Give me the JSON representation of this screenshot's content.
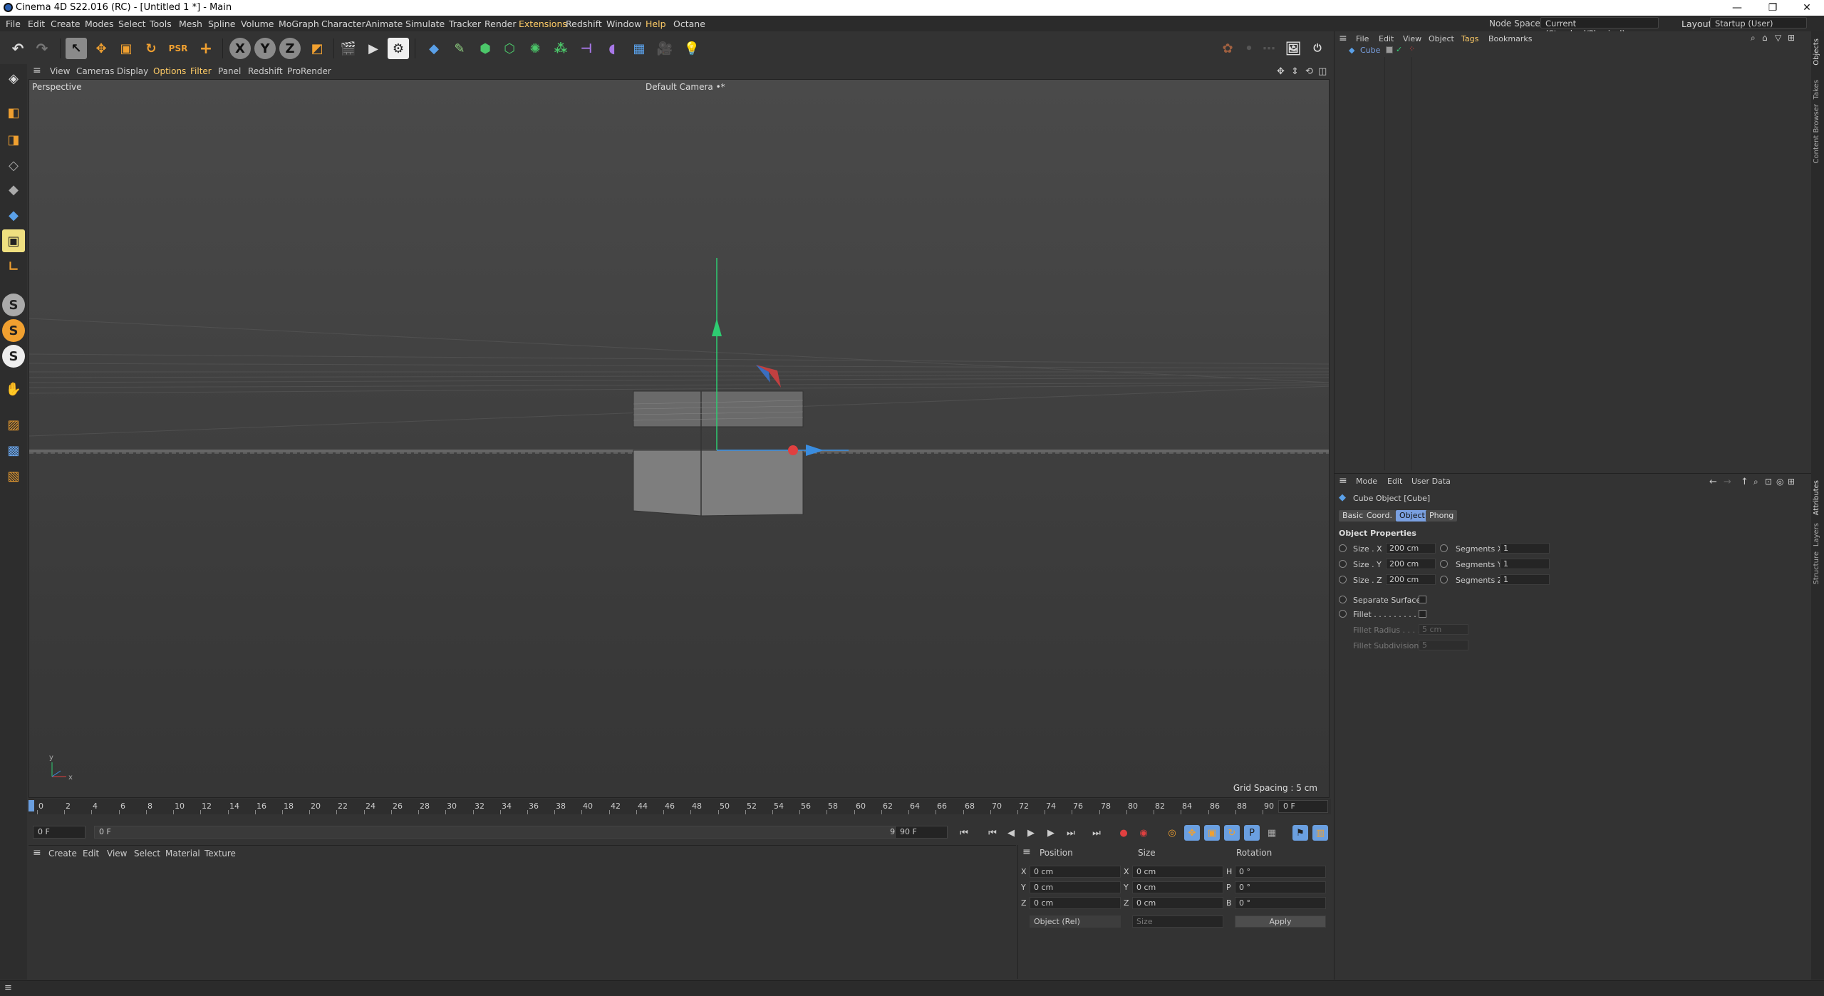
{
  "window": {
    "title": "Cinema 4D S22.016 (RC) - [Untitled 1 *] - Main",
    "minimize": "—",
    "restore": "❐",
    "close": "✕"
  },
  "menu": [
    "File",
    "Edit",
    "Create",
    "Modes",
    "Select",
    "Tools",
    "Mesh",
    "Spline",
    "Volume",
    "MoGraph",
    "Character",
    "Animate",
    "Simulate",
    "Tracker",
    "Render",
    "Extensions",
    "Redshift",
    "Window",
    "Help",
    "Octane"
  ],
  "node_space": {
    "label": "Node Space:",
    "value": "Current (Standard/Physical)"
  },
  "layout": {
    "label": "Layout:",
    "value": "Startup (User)"
  },
  "toolbar": {
    "axis_x": "X",
    "axis_y": "Y",
    "axis_z": "Z"
  },
  "viewport": {
    "menu": [
      "View",
      "Cameras",
      "Display",
      "Options",
      "Filter",
      "Panel",
      "Redshift",
      "ProRender"
    ],
    "label": "Perspective",
    "camera": "Default Camera",
    "camera_mark": "•*",
    "grid_spacing": "Grid Spacing : 5 cm"
  },
  "timeline": {
    "ticks": [
      "0",
      "2",
      "4",
      "6",
      "8",
      "10",
      "12",
      "14",
      "16",
      "18",
      "20",
      "22",
      "24",
      "26",
      "28",
      "30",
      "32",
      "34",
      "36",
      "38",
      "40",
      "42",
      "44",
      "46",
      "48",
      "50",
      "52",
      "54",
      "56",
      "58",
      "60",
      "62",
      "64",
      "66",
      "68",
      "70",
      "72",
      "74",
      "76",
      "78",
      "80",
      "82",
      "84",
      "86",
      "88",
      "90"
    ],
    "current_frame": "0 F"
  },
  "transport": {
    "start": "0 F",
    "range_start": "0 F",
    "range_end": "90 F",
    "end": "90 F"
  },
  "material_manager": {
    "menu": [
      "Create",
      "Edit",
      "View",
      "Select",
      "Material",
      "Texture"
    ]
  },
  "coords": {
    "headers": [
      "Position",
      "Size",
      "Rotation"
    ],
    "rows": [
      {
        "pos_axis": "X",
        "pos": "0 cm",
        "size_axis": "X",
        "size": "0 cm",
        "rot_axis": "H",
        "rot": "0 °"
      },
      {
        "pos_axis": "Y",
        "pos": "0 cm",
        "size_axis": "Y",
        "size": "0 cm",
        "rot_axis": "P",
        "rot": "0 °"
      },
      {
        "pos_axis": "Z",
        "pos": "0 cm",
        "size_axis": "Z",
        "size": "0 cm",
        "rot_axis": "B",
        "rot": "0 °"
      }
    ],
    "mode": "Object (Rel)",
    "size_mode": "Size",
    "apply": "Apply"
  },
  "objects": {
    "menu": [
      "File",
      "Edit",
      "View",
      "Object",
      "Tags",
      "Bookmarks"
    ],
    "items": [
      {
        "name": "Cube"
      }
    ]
  },
  "attributes": {
    "menu": [
      "Mode",
      "Edit",
      "User Data"
    ],
    "title": "Cube Object [Cube]",
    "tabs": [
      "Basic",
      "Coord.",
      "Object",
      "Phong"
    ],
    "active_tab": "Object",
    "section": "Object Properties",
    "size_x_label": "Size . X",
    "size_x": "200 cm",
    "size_y_label": "Size . Y",
    "size_y": "200 cm",
    "size_z_label": "Size . Z",
    "size_z": "200 cm",
    "seg_x_label": "Segments X",
    "seg_x": "1",
    "seg_y_label": "Segments Y",
    "seg_y": "1",
    "seg_z_label": "Segments Z",
    "seg_z": "1",
    "separate_surfaces": "Separate Surfaces",
    "fillet": "Fillet . . . . . . . . .",
    "fillet_radius_label": "Fillet Radius . . . .",
    "fillet_radius": "5 cm",
    "fillet_subdiv_label": "Fillet Subdivision",
    "fillet_subdiv": "5"
  },
  "side_tabs_top": [
    "Objects",
    "Takes",
    "Content Browser"
  ],
  "side_tabs_bottom": [
    "Attributes",
    "Layers",
    "Structure"
  ],
  "colors": {
    "accent": "#7aa0e0",
    "axis_x": "#e04040",
    "axis_y": "#2ecc71",
    "axis_z": "#3a8de0",
    "playhead": "#6a9fe0"
  }
}
